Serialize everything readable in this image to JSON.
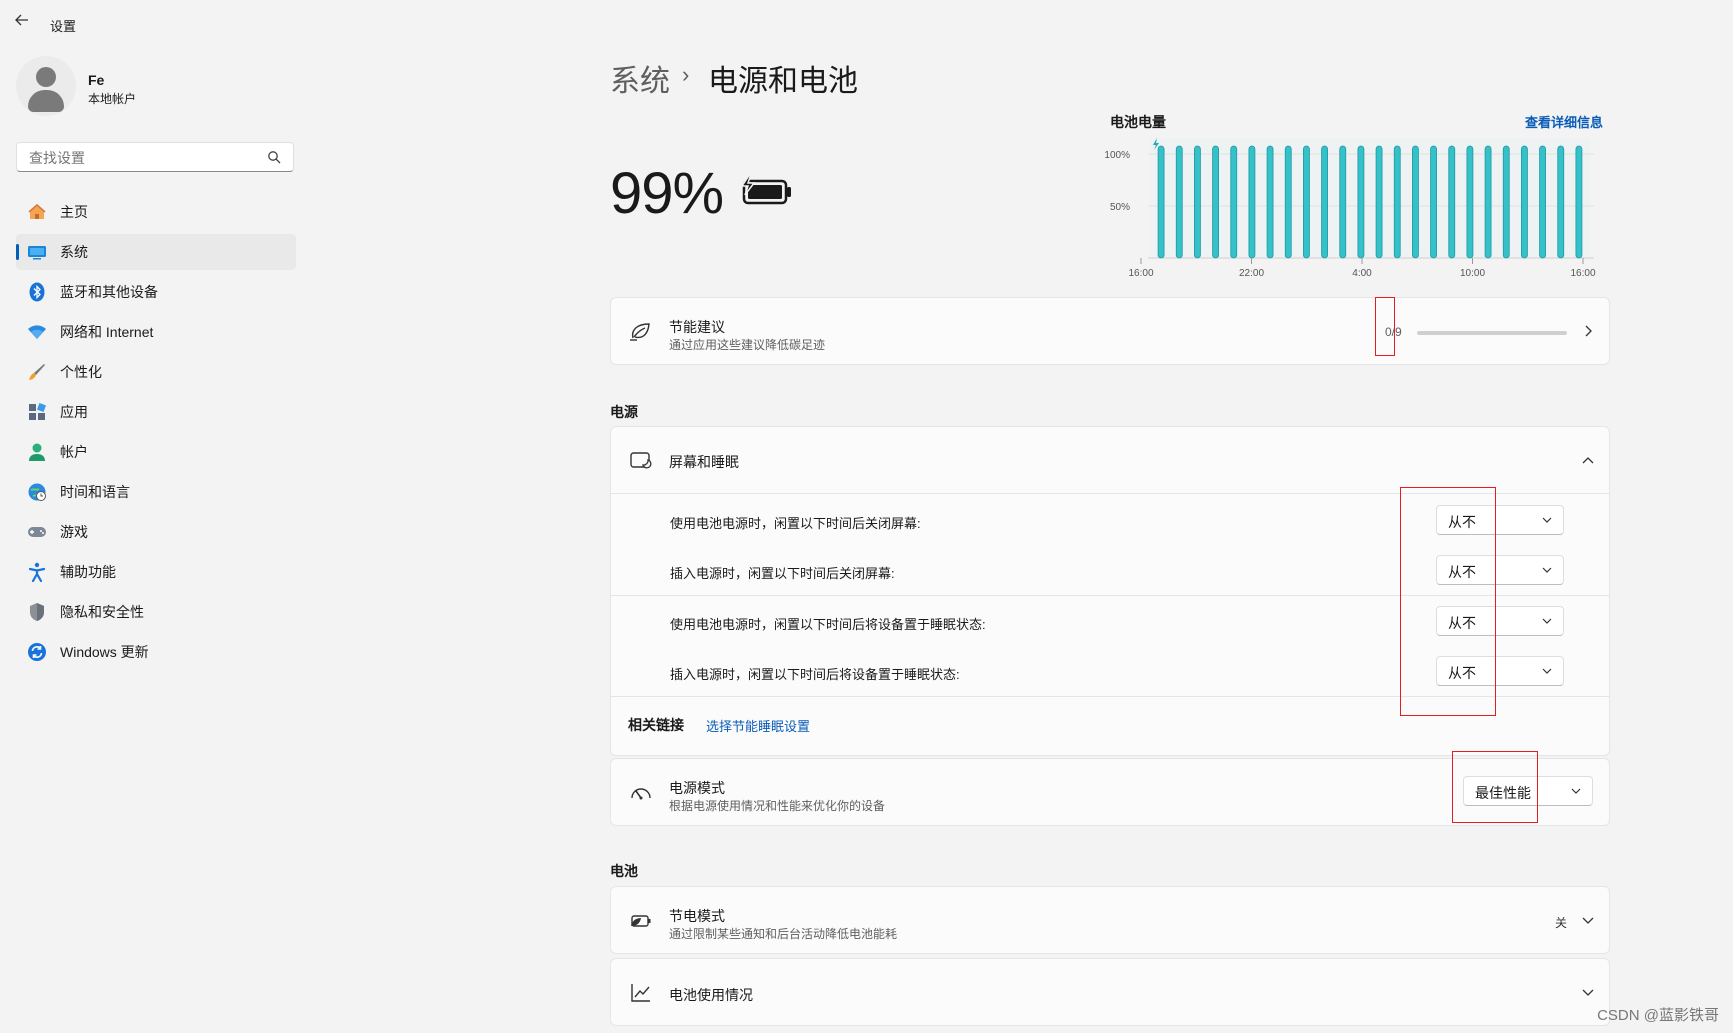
{
  "window": {
    "title": "设置"
  },
  "account": {
    "name": "Fe",
    "type": "本地帐户"
  },
  "search": {
    "placeholder": "查找设置"
  },
  "nav": [
    {
      "label": "主页",
      "icon": "home-icon"
    },
    {
      "label": "系统",
      "icon": "system-icon",
      "selected": true
    },
    {
      "label": "蓝牙和其他设备",
      "icon": "bluetooth-icon"
    },
    {
      "label": "网络和 Internet",
      "icon": "wifi-icon"
    },
    {
      "label": "个性化",
      "icon": "brush-icon"
    },
    {
      "label": "应用",
      "icon": "apps-icon"
    },
    {
      "label": "帐户",
      "icon": "account-icon"
    },
    {
      "label": "时间和语言",
      "icon": "globe-clock-icon"
    },
    {
      "label": "游戏",
      "icon": "gamepad-icon"
    },
    {
      "label": "辅助功能",
      "icon": "accessibility-icon"
    },
    {
      "label": "隐私和安全性",
      "icon": "shield-icon"
    },
    {
      "label": "Windows 更新",
      "icon": "update-icon"
    }
  ],
  "header": {
    "breadcrumb_parent": "系统",
    "breadcrumb_current": "电源和电池"
  },
  "battery": {
    "percent_text": "99%",
    "level": 0.99,
    "charging": true
  },
  "chart_data": {
    "type": "bar",
    "title": "电池电量",
    "link": "查看详细信息",
    "x_tick_labels": [
      "16:00",
      "22:00",
      "4:00",
      "10:00",
      "16:00"
    ],
    "y_tick_labels": [
      "100%",
      "50%"
    ],
    "ylim": [
      0,
      100
    ],
    "bar_count": 24,
    "values": [
      100,
      100,
      100,
      100,
      100,
      100,
      100,
      100,
      100,
      100,
      100,
      100,
      100,
      100,
      100,
      100,
      100,
      100,
      100,
      100,
      100,
      100,
      100,
      100
    ],
    "color": "#36c0c8"
  },
  "energy_recommendations": {
    "title": "节能建议",
    "subtitle": "通过应用这些建议降低碳足迹",
    "progress_text": "0/9",
    "progress": 0
  },
  "power_section": {
    "heading": "电源"
  },
  "screen_sleep": {
    "title": "屏幕和睡眠",
    "rows": [
      {
        "label": "使用电池电源时，闲置以下时间后关闭屏幕:",
        "value": "从不"
      },
      {
        "label": "插入电源时，闲置以下时间后关闭屏幕:",
        "value": "从不"
      },
      {
        "label": "使用电池电源时，闲置以下时间后将设备置于睡眠状态:",
        "value": "从不"
      },
      {
        "label": "插入电源时，闲置以下时间后将设备置于睡眠状态:",
        "value": "从不"
      }
    ],
    "related_label": "相关链接",
    "related_link": "选择节能睡眠设置"
  },
  "power_mode": {
    "title": "电源模式",
    "subtitle": "根据电源使用情况和性能来优化你的设备",
    "value": "最佳性能"
  },
  "battery_section": {
    "heading": "电池"
  },
  "battery_saver": {
    "title": "节电模式",
    "subtitle": "通过限制某些通知和后台活动降低电池能耗",
    "state": "关"
  },
  "battery_usage": {
    "title": "电池使用情况"
  },
  "watermark": "CSDN @蓝影铁哥",
  "colors": {
    "accent": "#005fb8",
    "link": "#0a5cb8",
    "chart_bar": "#36c0c8",
    "highlight": "#e02020"
  }
}
